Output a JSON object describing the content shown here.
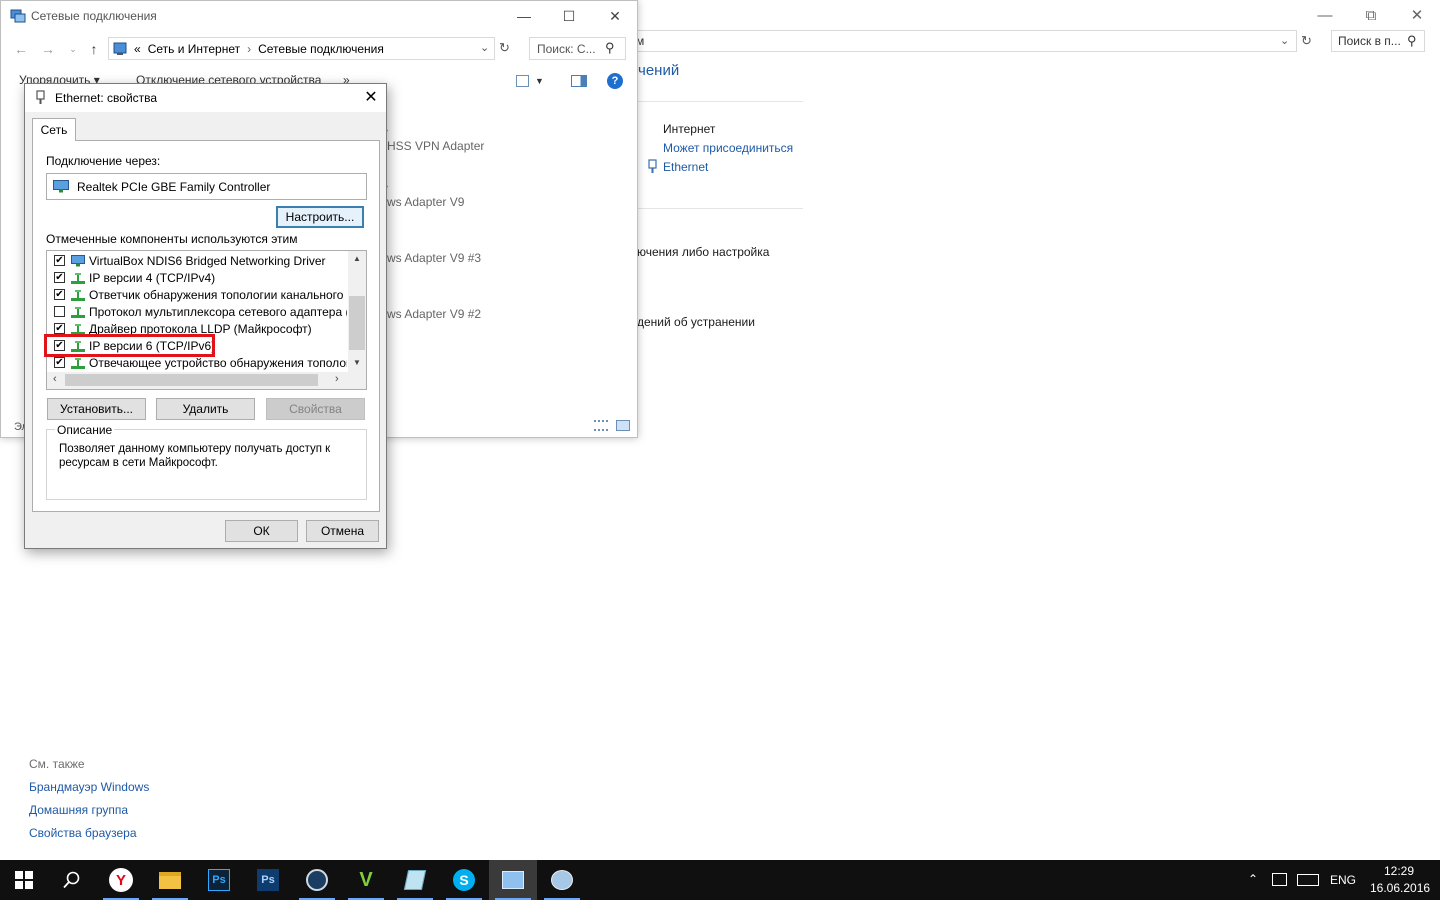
{
  "bg_window": {
    "address": "м",
    "search_placeholder": "Поиск в п...",
    "heading": "чений",
    "internet_label": "Интернет",
    "connect_link": "Может присоединиться",
    "ethernet_link": "Ethernet",
    "task1": "ючения либо настройка",
    "task2": "дений об устранении"
  },
  "see_also": {
    "title": "См. также",
    "links": [
      "Брандмауэр Windows",
      "Домашняя группа",
      "Свойства браузера"
    ]
  },
  "nc_window": {
    "title": "Сетевые подключения",
    "breadcrumb": [
      "«",
      "Сеть и Интернет",
      "Сетевые подключения"
    ],
    "search_placeholder": "Поиск: С...",
    "toolbar": [
      "Упорядочить ▾",
      "Отключение сетевого устройства",
      "»"
    ],
    "items": [
      "HSS VPN Adapter",
      "ws Adapter V9",
      "ws Adapter V9 #3",
      "ws Adapter V9 #2"
    ],
    "status_left": "Эл"
  },
  "dialog": {
    "title": "Ethernet: свойства",
    "tab": "Сеть",
    "connect_via_label": "Подключение через:",
    "adapter": "Realtek PCIe GBE Family Controller",
    "configure_button": "Настроить...",
    "components_label": "Отмеченные компоненты используются этим подключением:",
    "components": [
      {
        "name": "VirtualBox NDIS6 Bridged Networking Driver",
        "checked": true,
        "icon": "network-adapter-icon"
      },
      {
        "name": "IP версии 4 (TCP/IPv4)",
        "checked": true,
        "icon": "protocol-icon"
      },
      {
        "name": "Ответчик обнаружения топологии канального уровня",
        "checked": true,
        "icon": "protocol-icon"
      },
      {
        "name": "Протокол мультиплексора сетевого адаптера (Майкрософт)",
        "checked": false,
        "icon": "protocol-icon"
      },
      {
        "name": "Драйвер протокола LLDP (Майкрософт)",
        "checked": true,
        "icon": "protocol-icon"
      },
      {
        "name": "IP версии 6 (TCP/IPv6)",
        "checked": true,
        "icon": "protocol-icon"
      },
      {
        "name": "Отвечающее устройство обнаружения топологии канального уровня",
        "checked": true,
        "icon": "protocol-icon"
      }
    ],
    "install_button": "Установить...",
    "remove_button": "Удалить",
    "properties_button": "Свойства",
    "description_legend": "Описание",
    "description_text": "Позволяет данному компьютеру получать доступ к ресурсам в сети Майкрософт.",
    "ok_button": "ОК",
    "cancel_button": "Отмена"
  },
  "taskbar": {
    "lang": "ENG",
    "time": "12:29",
    "date": "16.06.2016",
    "apps": [
      "yandex-browser-icon",
      "file-explorer-icon",
      "photoshop-icon",
      "photoshop-icon",
      "steam-icon",
      "vegas-icon",
      "notepad-icon",
      "skype-icon",
      "network-connections-icon",
      "paint-icon"
    ]
  },
  "colors": {
    "accent": "#1e5aa6",
    "highlight_red": "#e0131b",
    "taskbar": "#101010"
  }
}
